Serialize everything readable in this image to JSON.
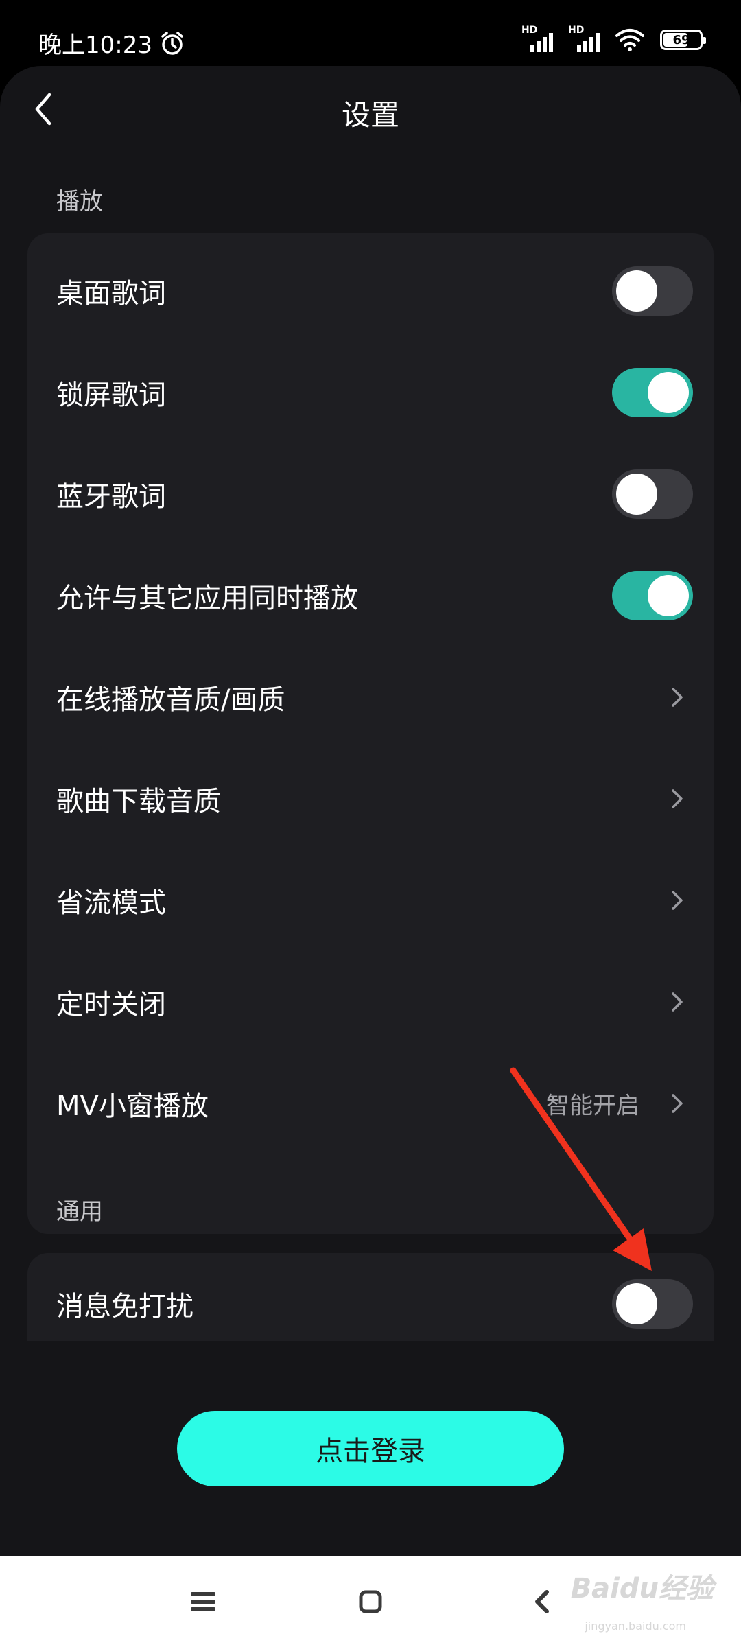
{
  "status_bar": {
    "time": "晚上10:23",
    "signal_1_label": "HD",
    "signal_2_label": "HD",
    "battery": "69"
  },
  "header": {
    "title": "设置",
    "back_icon": "back-arrow-icon"
  },
  "sections": {
    "playback": {
      "label": "播放",
      "rows": [
        {
          "label": "桌面歌词",
          "type": "toggle",
          "on": false
        },
        {
          "label": "锁屏歌词",
          "type": "toggle",
          "on": true
        },
        {
          "label": "蓝牙歌词",
          "type": "toggle",
          "on": false
        },
        {
          "label": "允许与其它应用同时播放",
          "type": "toggle",
          "on": true
        },
        {
          "label": "在线播放音质/画质",
          "type": "link"
        },
        {
          "label": "歌曲下载音质",
          "type": "link"
        },
        {
          "label": "省流模式",
          "type": "link"
        },
        {
          "label": "定时关闭",
          "type": "link"
        },
        {
          "label": "MV小窗播放",
          "type": "link",
          "value": "智能开启"
        }
      ]
    },
    "general": {
      "label": "通用",
      "rows": [
        {
          "label": "消息免打扰",
          "type": "toggle",
          "on": false
        }
      ]
    }
  },
  "login_button": "点击登录",
  "nav_bar": {
    "icons": [
      "menu-icon",
      "home-square-icon",
      "back-chevron-icon"
    ],
    "watermark": "Baidu经验",
    "watermark_sub": "jingyan.baidu.com"
  },
  "colors": {
    "background": "#151518",
    "card": "#1e1e22",
    "toggle_on": "#29b5a2",
    "toggle_off": "#3b3b40",
    "login_button": "#2cfbe6",
    "annotation_arrow": "#f0321e"
  }
}
